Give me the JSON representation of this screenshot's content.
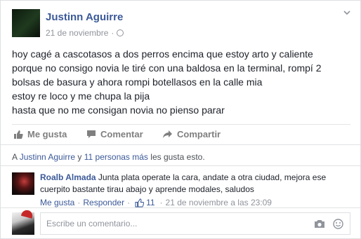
{
  "post": {
    "author": "Justinn Aguirre",
    "date": "21 de noviembre",
    "separator": "·",
    "text_lines": [
      "hoy cagé a cascotasos a dos perros encima que estoy arto y caliente",
      "porque no consigo novia le tiré con una baldosa en la terminal, rompí 2",
      "bolsas de basura y ahora rompi botellasos en la calle mia",
      "estoy re loco y me chupa la pija",
      "hasta que no me consigan novia no pienso parar"
    ],
    "icons": {
      "privacy": "globe-icon",
      "menu": "chevron-down-icon"
    }
  },
  "actions": {
    "like": "Me gusta",
    "comment": "Comentar",
    "share": "Compartir"
  },
  "likes_summary": {
    "prefix": "A",
    "name": "Justinn Aguirre",
    "conj": "y",
    "others": "11 personas más",
    "suffix": "les gusta esto."
  },
  "comment": {
    "author": "Roalb Almada",
    "text": "Junta plata operate la cara, andate a otra ciudad, mejora ese cuerpito bastante tirau abajo y aprende modales, saludos",
    "like_label": "Me gusta",
    "dot": "·",
    "reply_label": "Responder",
    "like_count": "11",
    "timestamp": "21 de noviembre a las 23:09"
  },
  "composer": {
    "placeholder": "Escribe un comentario..."
  },
  "colors": {
    "link": "#3b5998",
    "muted": "#90949c",
    "action": "#7f7f7f"
  }
}
